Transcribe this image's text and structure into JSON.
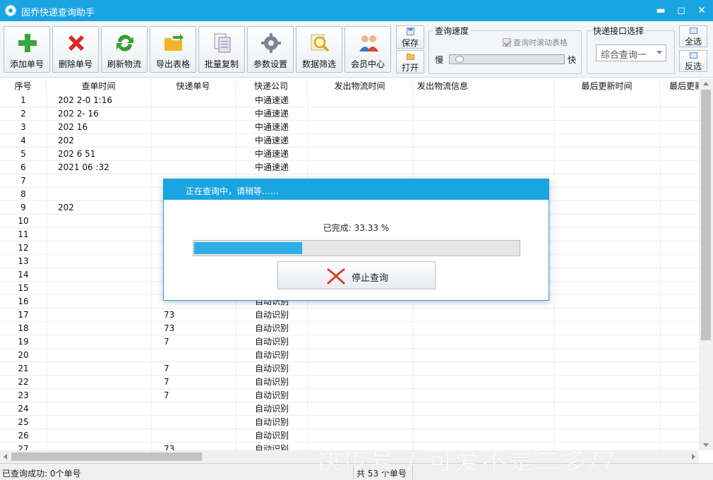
{
  "window": {
    "title": "固乔快递查询助手",
    "controls": {
      "minimize": "▬",
      "maximize": "◻",
      "close": "✕"
    }
  },
  "toolbar": {
    "buttons": [
      {
        "label": "添加单号",
        "icon": "add-icon"
      },
      {
        "label": "删除单号",
        "icon": "delete-icon"
      },
      {
        "label": "刷新物流",
        "icon": "refresh-icon"
      },
      {
        "label": "导出表格",
        "icon": "export-folder-icon"
      },
      {
        "label": "批量复制",
        "icon": "copy-icon"
      },
      {
        "label": "参数设置",
        "icon": "gear-icon"
      },
      {
        "label": "数据筛选",
        "icon": "magnifier-icon"
      },
      {
        "label": "会员中心",
        "icon": "members-icon"
      }
    ],
    "save_label": "保存",
    "open_label": "打开",
    "speed_group": {
      "title": "查询速度",
      "scroll_table_label": "查询时滚动表格",
      "scroll_table_checked": true,
      "slow_label": "慢",
      "fast_label": "快",
      "speed_level": 0.05
    },
    "api_group": {
      "title": "快递接口选择",
      "selected": "综合查询一"
    },
    "select_all_label": "全选",
    "invert_label": "反选"
  },
  "table": {
    "columns": [
      "序号",
      "查单时间",
      "快递单号",
      "快递公司",
      "发出物流时间",
      "发出物流信息",
      "最后更新时间",
      "最后更新"
    ],
    "rows": [
      {
        "no": "1",
        "time": "202  2-0   1:16",
        "num": "",
        "company": "中通速递"
      },
      {
        "no": "2",
        "time": "202  2-    16",
        "num": "",
        "company": "中通速递"
      },
      {
        "no": "3",
        "time": "202        16",
        "num": "",
        "company": "中通速递"
      },
      {
        "no": "4",
        "time": "202",
        "num": "",
        "company": "中通速递"
      },
      {
        "no": "5",
        "time": "202    6     51",
        "num": "",
        "company": "中通速递"
      },
      {
        "no": "6",
        "time": "2021    06   :32",
        "num": "",
        "company": "中通速递"
      },
      {
        "no": "7",
        "time": "",
        "num": "",
        "company": ""
      },
      {
        "no": "8",
        "time": "",
        "num": "",
        "company": ""
      },
      {
        "no": "9",
        "time": "202",
        "num": "",
        "company": ""
      },
      {
        "no": "10",
        "time": "",
        "num": "",
        "company": ""
      },
      {
        "no": "11",
        "time": "",
        "num": "",
        "company": ""
      },
      {
        "no": "12",
        "time": "",
        "num": "",
        "company": ""
      },
      {
        "no": "13",
        "time": "",
        "num": "",
        "company": ""
      },
      {
        "no": "14",
        "time": "",
        "num": "",
        "company": ""
      },
      {
        "no": "15",
        "time": "",
        "num": "",
        "company": ""
      },
      {
        "no": "16",
        "time": "",
        "num": "",
        "company": "自动识别"
      },
      {
        "no": "17",
        "time": "",
        "num": "73",
        "company": "自动识别"
      },
      {
        "no": "18",
        "time": "",
        "num": "73",
        "company": "自动识别"
      },
      {
        "no": "19",
        "time": "",
        "num": "7",
        "company": "自动识别"
      },
      {
        "no": "20",
        "time": "",
        "num": "",
        "company": "自动识别"
      },
      {
        "no": "21",
        "time": "",
        "num": "7",
        "company": "自动识别"
      },
      {
        "no": "22",
        "time": "",
        "num": "7",
        "company": "自动识别"
      },
      {
        "no": "23",
        "time": "",
        "num": "7",
        "company": "自动识别"
      },
      {
        "no": "24",
        "time": "",
        "num": "",
        "company": "自动识别"
      },
      {
        "no": "25",
        "time": "",
        "num": "",
        "company": "自动识别"
      },
      {
        "no": "26",
        "time": "",
        "num": "",
        "company": "自动识别"
      },
      {
        "no": "27",
        "time": "",
        "num": "73",
        "company": "自动识别"
      }
    ]
  },
  "dialog": {
    "title": "正在查询中，请稍等……",
    "progress_text": "已完成: 33.33 %",
    "progress_fraction": 0.3333,
    "stop_label": "停止查询"
  },
  "status": {
    "left": "已查询成功: 0个单号",
    "right": "共 53 个单号"
  },
  "watermark": "快传号 / 可爱不是二多/7",
  "colors": {
    "accent": "#1aa4e2",
    "progress": "#2eaee6"
  }
}
